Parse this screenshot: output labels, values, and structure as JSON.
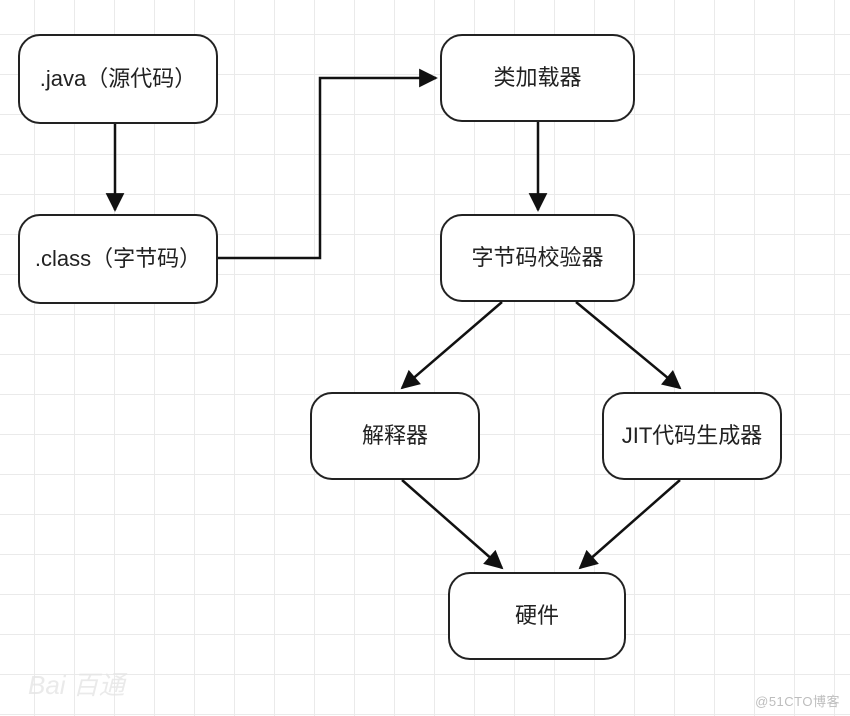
{
  "nodes": {
    "source": ".java（源代码）",
    "class": ".class（字节码）",
    "classloader": "类加载器",
    "verifier": "字节码校验器",
    "interpreter": "解释器",
    "jit": "JIT代码生成器",
    "hardware": "硬件"
  },
  "watermarks": {
    "right": "@51CTO博客",
    "left": "Bai 百通"
  },
  "chart_data": {
    "type": "flowchart",
    "title": "",
    "nodes": [
      {
        "id": "source",
        "label": ".java（源代码）"
      },
      {
        "id": "class",
        "label": ".class（字节码）"
      },
      {
        "id": "classloader",
        "label": "类加载器"
      },
      {
        "id": "verifier",
        "label": "字节码校验器"
      },
      {
        "id": "interpreter",
        "label": "解释器"
      },
      {
        "id": "jit",
        "label": "JIT代码生成器"
      },
      {
        "id": "hardware",
        "label": "硬件"
      }
    ],
    "edges": [
      {
        "from": "source",
        "to": "class"
      },
      {
        "from": "class",
        "to": "classloader"
      },
      {
        "from": "classloader",
        "to": "verifier"
      },
      {
        "from": "verifier",
        "to": "interpreter"
      },
      {
        "from": "verifier",
        "to": "jit"
      },
      {
        "from": "interpreter",
        "to": "hardware"
      },
      {
        "from": "jit",
        "to": "hardware"
      }
    ]
  }
}
